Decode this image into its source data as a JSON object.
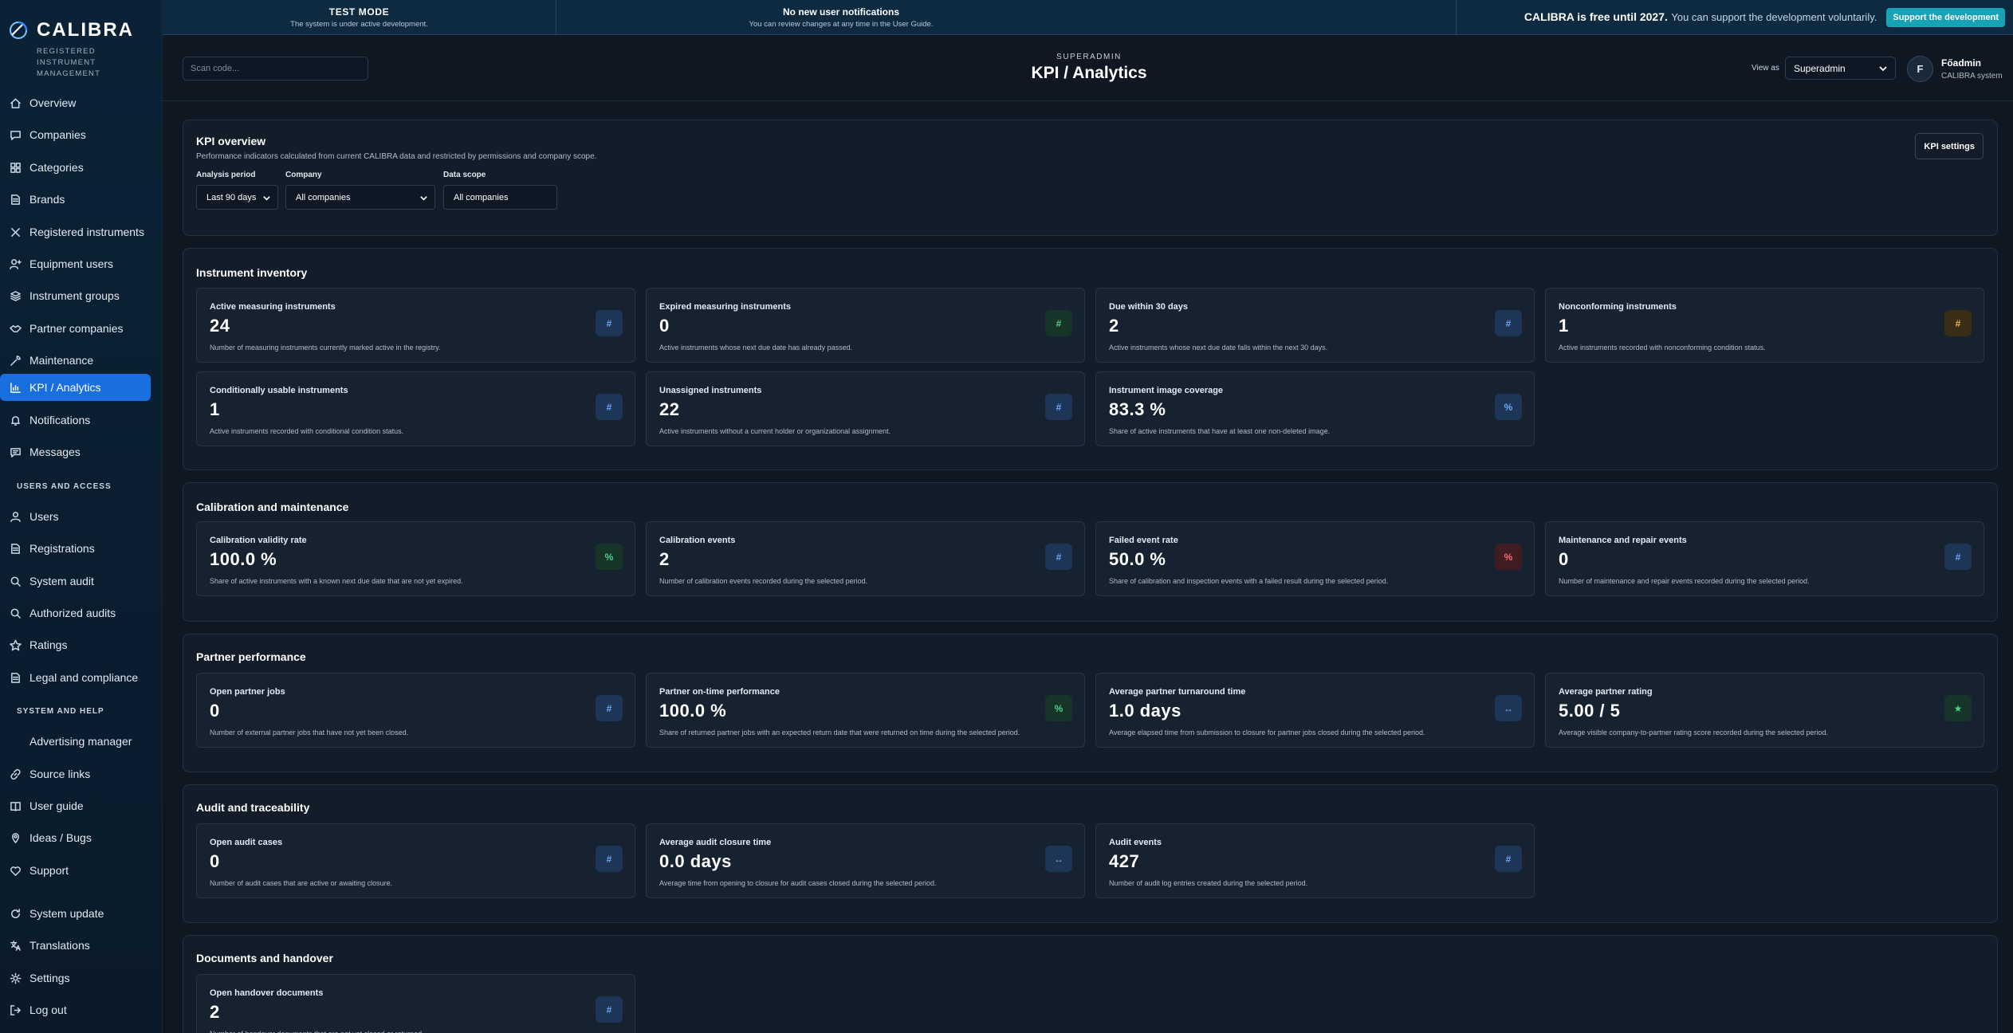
{
  "brand": {
    "name": "CALIBRA",
    "subtitle": "REGISTERED INSTRUMENT MANAGEMENT"
  },
  "banner": {
    "test_title": "TEST MODE",
    "test_sub": "The system is under active development.",
    "notif_title": "No new user notifications",
    "notif_sub": "You can review changes at any time in the User Guide.",
    "free_bold": "CALIBRA is free until 2027.",
    "free_text": "You can support the development voluntarily.",
    "support_button": "Support the development"
  },
  "sidebar": {
    "items": [
      {
        "label": "Overview",
        "icon": "home-icon"
      },
      {
        "label": "Companies",
        "icon": "chat-icon"
      },
      {
        "label": "Categories",
        "icon": "grid-icon"
      },
      {
        "label": "Brands",
        "icon": "doc-icon"
      },
      {
        "label": "Registered instruments",
        "icon": "cross-tools-icon"
      },
      {
        "label": "Equipment users",
        "icon": "user-plus-icon"
      },
      {
        "label": "Instrument groups",
        "icon": "layers-icon"
      },
      {
        "label": "Partner companies",
        "icon": "handshake-icon"
      },
      {
        "label": "Maintenance",
        "icon": "wrench-icon"
      },
      {
        "label": "KPI / Analytics",
        "icon": "chart-icon"
      },
      {
        "label": "Notifications",
        "icon": "bell-icon"
      },
      {
        "label": "Messages",
        "icon": "message-icon"
      }
    ],
    "section_users": "USERS AND ACCESS",
    "users_items": [
      {
        "label": "Users",
        "icon": "user-icon"
      },
      {
        "label": "Registrations",
        "icon": "doc-icon"
      },
      {
        "label": "System audit",
        "icon": "search-icon"
      },
      {
        "label": "Authorized audits",
        "icon": "search-icon"
      },
      {
        "label": "Ratings",
        "icon": "star-icon"
      },
      {
        "label": "Legal and compliance",
        "icon": "doc-icon"
      }
    ],
    "section_system": "SYSTEM AND HELP",
    "system_items": [
      {
        "label": "Advertising manager",
        "icon": ""
      },
      {
        "label": "Source links",
        "icon": "link-icon"
      },
      {
        "label": "User guide",
        "icon": "book-icon"
      },
      {
        "label": "Ideas / Bugs",
        "icon": "pin-icon"
      },
      {
        "label": "Support",
        "icon": "heart-icon"
      },
      {
        "label": "System update",
        "icon": "refresh-icon"
      },
      {
        "label": "Translations",
        "icon": "translate-icon"
      },
      {
        "label": "Settings",
        "icon": "gear-icon"
      },
      {
        "label": "Log out",
        "icon": "logout-icon"
      }
    ]
  },
  "header": {
    "scan_placeholder": "Scan code...",
    "role": "SUPERADMIN",
    "title": "KPI / Analytics",
    "view_as_label": "View as",
    "view_as_value": "Superadmin",
    "avatar_initial": "F",
    "user_name": "Főadmin",
    "user_sub": "CALIBRA system"
  },
  "overview": {
    "title": "KPI overview",
    "subtitle": "Performance indicators calculated from current CALIBRA data and restricted by permissions and company scope.",
    "settings_button": "KPI settings",
    "filters": {
      "period_label": "Analysis period",
      "period_value": "Last 90 days",
      "company_label": "Company",
      "company_value": "All companies",
      "scope_label": "Data scope",
      "scope_value": "All companies"
    }
  },
  "sections": {
    "inventory": {
      "title": "Instrument inventory",
      "cards": [
        {
          "title": "Active measuring instruments",
          "value": "24",
          "desc": "Number of measuring instruments currently marked active in the registry.",
          "badge": "#",
          "tone": "blue"
        },
        {
          "title": "Expired measuring instruments",
          "value": "0",
          "desc": "Active instruments whose next due date has already passed.",
          "badge": "#",
          "tone": "green"
        },
        {
          "title": "Due within 30 days",
          "value": "2",
          "desc": "Active instruments whose next due date falls within the next 30 days.",
          "badge": "#",
          "tone": "blue"
        },
        {
          "title": "Nonconforming instruments",
          "value": "1",
          "desc": "Active instruments recorded with nonconforming condition status.",
          "badge": "#",
          "tone": "amber"
        },
        {
          "title": "Conditionally usable instruments",
          "value": "1",
          "desc": "Active instruments recorded with conditional condition status.",
          "badge": "#",
          "tone": "blue"
        },
        {
          "title": "Unassigned instruments",
          "value": "22",
          "desc": "Active instruments without a current holder or organizational assignment.",
          "badge": "#",
          "tone": "blue"
        },
        {
          "title": "Instrument image coverage",
          "value": "83.3 %",
          "desc": "Share of active instruments that have at least one non-deleted image.",
          "badge": "%",
          "tone": "blue"
        }
      ]
    },
    "calibration": {
      "title": "Calibration and maintenance",
      "cards": [
        {
          "title": "Calibration validity rate",
          "value": "100.0 %",
          "desc": "Share of active instruments with a known next due date that are not yet expired.",
          "badge": "%",
          "tone": "green"
        },
        {
          "title": "Calibration events",
          "value": "2",
          "desc": "Number of calibration events recorded during the selected period.",
          "badge": "#",
          "tone": "blue"
        },
        {
          "title": "Failed event rate",
          "value": "50.0 %",
          "desc": "Share of calibration and inspection events with a failed result during the selected period.",
          "badge": "%",
          "tone": "red"
        },
        {
          "title": "Maintenance and repair events",
          "value": "0",
          "desc": "Number of maintenance and repair events recorded during the selected period.",
          "badge": "#",
          "tone": "blue"
        }
      ]
    },
    "partner": {
      "title": "Partner performance",
      "cards": [
        {
          "title": "Open partner jobs",
          "value": "0",
          "desc": "Number of external partner jobs that have not yet been closed.",
          "badge": "#",
          "tone": "blue"
        },
        {
          "title": "Partner on-time performance",
          "value": "100.0 %",
          "desc": "Share of returned partner jobs with an expected return date that were returned on time during the selected period.",
          "badge": "%",
          "tone": "green"
        },
        {
          "title": "Average partner turnaround time",
          "value": "1.0 days",
          "desc": "Average elapsed time from submission to closure for partner jobs closed during the selected period.",
          "badge": "↔",
          "tone": "blue"
        },
        {
          "title": "Average partner rating",
          "value": "5.00 / 5",
          "desc": "Average visible company-to-partner rating score recorded during the selected period.",
          "badge": "★",
          "tone": "green"
        }
      ]
    },
    "audit": {
      "title": "Audit and traceability",
      "cards": [
        {
          "title": "Open audit cases",
          "value": "0",
          "desc": "Number of audit cases that are active or awaiting closure.",
          "badge": "#",
          "tone": "blue"
        },
        {
          "title": "Average audit closure time",
          "value": "0.0 days",
          "desc": "Average time from opening to closure for audit cases closed during the selected period.",
          "badge": "↔",
          "tone": "blue"
        },
        {
          "title": "Audit events",
          "value": "427",
          "desc": "Number of audit log entries created during the selected period.",
          "badge": "#",
          "tone": "blue"
        }
      ]
    },
    "documents": {
      "title": "Documents and handover",
      "cards": [
        {
          "title": "Open handover documents",
          "value": "2",
          "desc": "Number of handover documents that are not yet closed or returned.",
          "badge": "#",
          "tone": "blue"
        }
      ]
    }
  },
  "colors": {
    "accent": "#1a6fe0",
    "support": "#16a3b5",
    "bg": "#0f1722",
    "panel": "#131d2a"
  }
}
